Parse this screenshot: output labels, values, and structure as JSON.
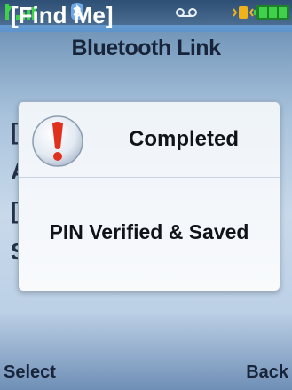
{
  "title": "Bluetooth Link",
  "status_bar": {
    "icons": [
      "signal-icon",
      "bluetooth-icon",
      "voicemail-icon",
      "vibrate-icon",
      "battery-icon"
    ]
  },
  "list": {
    "selected_item": "[Find Me]",
    "partial_items": [
      "[",
      "A",
      "[",
      "S"
    ]
  },
  "dialog": {
    "icon": "alert-icon",
    "title": "Completed",
    "message": "PIN Verified & Saved"
  },
  "softkeys": {
    "left": "Select",
    "right": "Back"
  },
  "colors": {
    "status_bar": "#2e4f74",
    "highlight": "#6fa3d6",
    "alert_red": "#e0301e"
  }
}
